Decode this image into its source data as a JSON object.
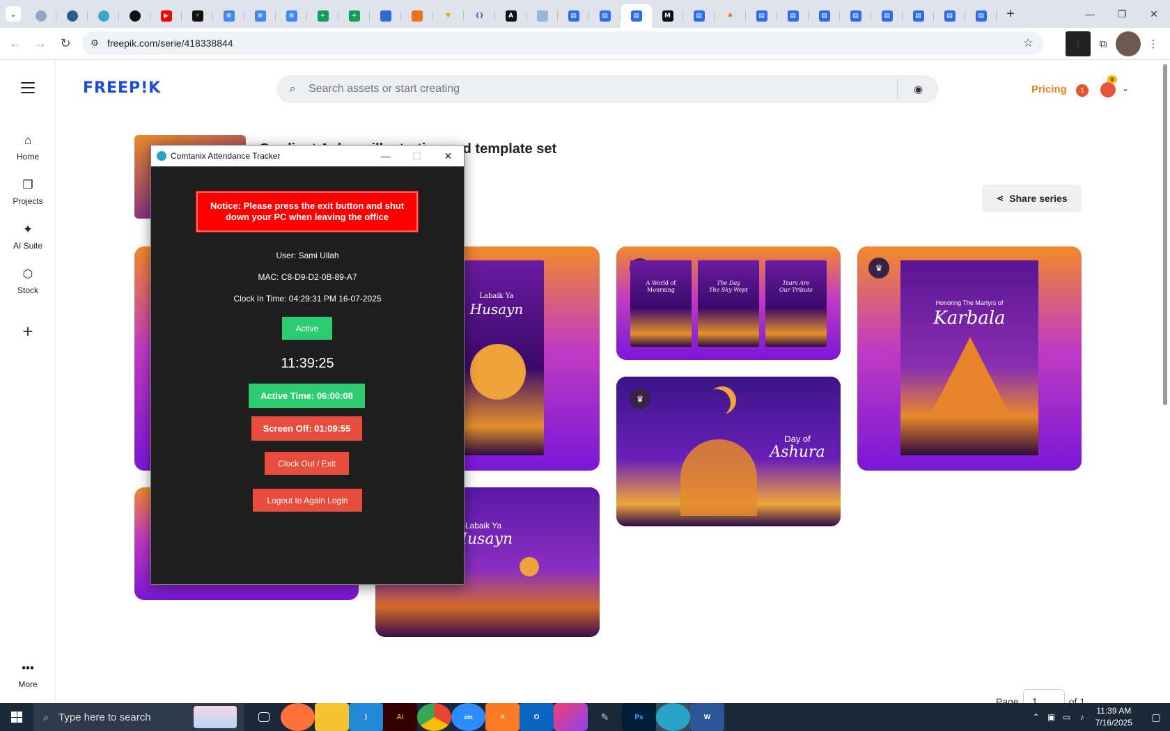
{
  "browser": {
    "url": "freepik.com/serie/418338844",
    "tab_count_label": "",
    "new_tab": "+"
  },
  "freepik": {
    "logo": "FREEP!K",
    "search_placeholder": "Search assets or start creating",
    "pricing": "Pricing",
    "notification_count": "1",
    "series_title": "Gradient Ashura illustration and template set",
    "share": "Share series",
    "sidebar": [
      {
        "label": "Home"
      },
      {
        "label": "Projects"
      },
      {
        "label": "AI Suite"
      },
      {
        "label": "Stock"
      }
    ],
    "more": "More",
    "pager": {
      "label": "Page",
      "value": "1",
      "of": "of 1"
    },
    "posters": {
      "husayn_top": {
        "line1": "Labaik Ya",
        "line2": "Husayn"
      },
      "husayn_bottom": {
        "line1": "Labaik Ya",
        "line2": "Husayn"
      },
      "triptych": [
        {
          "line1": "A World of",
          "line2": "Mourning"
        },
        {
          "line1": "The Day",
          "line2": "The Sky Wept"
        },
        {
          "line1": "Tears Are",
          "line2": "Our Tribute"
        }
      ],
      "ashura": {
        "line1": "Day of",
        "line2": "Ashura"
      },
      "karbala": {
        "line1": "Honoring The Martyrs of",
        "line2": "Karbala"
      }
    }
  },
  "tracker": {
    "title": "Comtanix Attendance Tracker",
    "notice": "Notice: Please press the exit button and shut down your PC when leaving the office",
    "user": "User: Sami Ullah",
    "mac": "MAC: C8-D9-D2-0B-89-A7",
    "clock_in": "Clock In Time: 04:29:31 PM 16-07-2025",
    "status": "Active",
    "clock": "11:39:25",
    "active_time": "Active Time: 06:00:08",
    "screen_off": "Screen Off: 01:09:55",
    "clock_out": "Clock Out / Exit",
    "logout": "Logout to Again Login"
  },
  "taskbar": {
    "search_placeholder": "Type here to search",
    "time": "11:39 AM",
    "date": "7/16/2025"
  },
  "colors": {
    "accent_blue": "#1a4ddc",
    "pricing_orange": "#e8841c",
    "status_green": "#2ecc71",
    "alert_red": "#e74c3c",
    "notice_red": "#ff0000"
  }
}
